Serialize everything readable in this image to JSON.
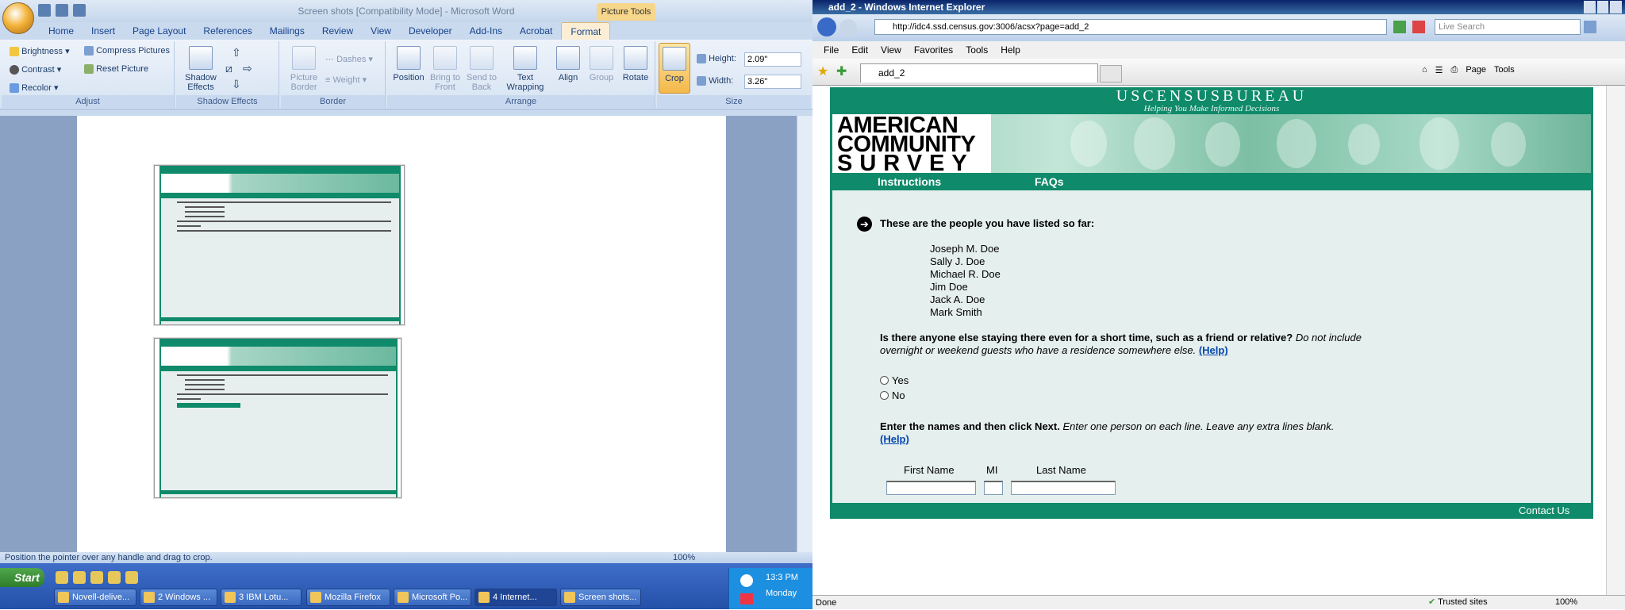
{
  "word": {
    "title": "Screen shots [Compatibility Mode] - Microsoft Word",
    "context_tab": "Picture Tools",
    "tabs": [
      "Home",
      "Insert",
      "Page Layout",
      "References",
      "Mailings",
      "Review",
      "View",
      "Developer",
      "Add-Ins",
      "Acrobat",
      "Format"
    ],
    "ribbon": {
      "brightness": "Brightness",
      "contrast": "Contrast",
      "recolor": "Recolor",
      "compress": "Compress Pictures",
      "reset": "Reset Picture",
      "adjust": "Adjust",
      "shadow_effects_btn": "Shadow Effects",
      "shadow_effects_group": "Shadow Effects",
      "picture_border": "Picture Border",
      "dashes": "Dashes",
      "weight": "Weight",
      "border_group": "Border",
      "position": "Position",
      "bring_to_front": "Bring to Front",
      "send_to_back": "Send to Back",
      "text_wrapping": "Text Wrapping",
      "align": "Align",
      "group": "Group",
      "rotate": "Rotate",
      "arrange_group": "Arrange",
      "crop": "Crop",
      "height_label": "Height:",
      "height_value": "2.09\"",
      "width_label": "Width:",
      "width_value": "3.26\"",
      "size_group": "Size"
    },
    "status_text": "Position the pointer over any handle and drag to crop.",
    "zoom": "100%"
  },
  "taskbar": {
    "start": "Start",
    "buttons": [
      "Novell-delive...",
      "2 Windows ...",
      "3 IBM Lotu...",
      "Mozilla Firefox",
      "Microsoft Po...",
      "4 Internet...",
      "Screen shots..."
    ],
    "time": "13:3 PM",
    "day": "Monday"
  },
  "ie": {
    "title": "add_2 - Windows Internet Explorer",
    "url": "http://idc4.ssd.census.gov:3006/acsx?page=add_2",
    "search_placeholder": "Live Search",
    "menu": [
      "File",
      "Edit",
      "View",
      "Favorites",
      "Tools",
      "Help"
    ],
    "tab_title": "add_2",
    "cmd_page": "Page",
    "cmd_tools": "Tools",
    "status": "Done",
    "zone": "Trusted sites",
    "zoom": "100%"
  },
  "acs": {
    "bureau": "USCENSUSBUREAU",
    "tagline": "Helping You Make Informed Decisions",
    "logo_lines": [
      "AMERICAN",
      "COMMUNITY",
      "SURVEY"
    ],
    "nav": [
      "Instructions",
      "FAQs"
    ],
    "listed_heading": "These are the people you have listed so far:",
    "people": [
      "Joseph M. Doe",
      "Sally J. Doe",
      "Michael R. Doe",
      "Jim Doe",
      "Jack A. Doe",
      "Mark Smith"
    ],
    "question_bold": "Is there anyone else staying there even for a short time, such as a friend or relative?",
    "question_italic": "Do not include overnight or weekend guests who have a residence somewhere else.",
    "help": "(Help)",
    "yes": "Yes",
    "no": "No",
    "enter_bold": "Enter the names and then click Next.",
    "enter_italic": "Enter one person on each line. Leave any extra lines blank.",
    "col_first": "First Name",
    "col_mi": "MI",
    "col_last": "Last Name",
    "contact": "Contact Us"
  },
  "colors": {
    "census_green": "#0f8a6a",
    "census_bg": "#e5efed",
    "link": "#0645ad"
  }
}
